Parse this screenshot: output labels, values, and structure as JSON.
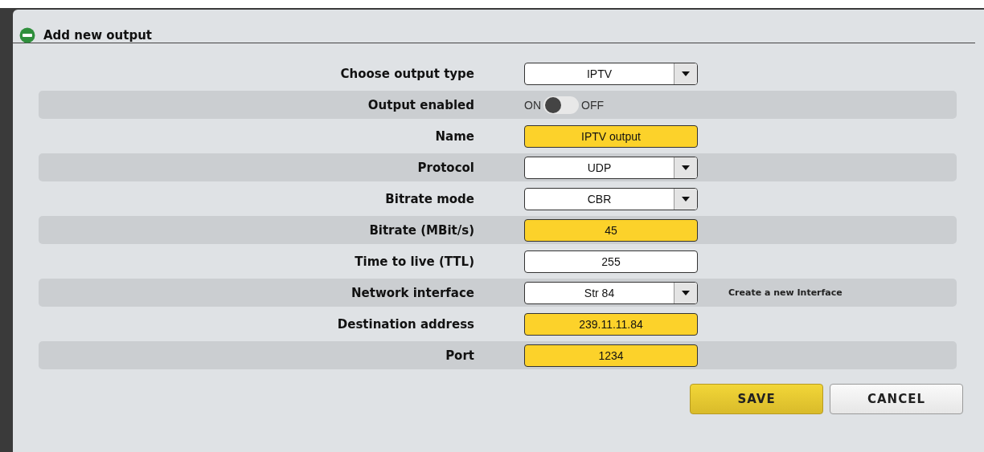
{
  "dialog": {
    "title": "Add new output"
  },
  "fields": [
    {
      "label": "Choose output type",
      "kind": "select",
      "value": "IPTV",
      "required": false
    },
    {
      "label": "Output enabled",
      "kind": "toggle",
      "on": false,
      "on_label": "ON",
      "off_label": "OFF"
    },
    {
      "label": "Name",
      "kind": "text",
      "value": "IPTV output",
      "required": true
    },
    {
      "label": "Protocol",
      "kind": "select",
      "value": "UDP",
      "required": false
    },
    {
      "label": "Bitrate mode",
      "kind": "select",
      "value": "CBR",
      "required": false
    },
    {
      "label": "Bitrate (MBit/s)",
      "kind": "text",
      "value": "45",
      "required": true
    },
    {
      "label": "Time to live (TTL)",
      "kind": "text",
      "value": "255",
      "required": false
    },
    {
      "label": "Network interface",
      "kind": "select",
      "value": "Str 84",
      "required": false,
      "link": "Create a new Interface"
    },
    {
      "label": "Destination address",
      "kind": "text",
      "value": "239.11.11.84",
      "required": true
    },
    {
      "label": "Port",
      "kind": "text",
      "value": "1234",
      "required": true
    }
  ],
  "buttons": [
    {
      "label": "SAVE",
      "kind": "primary"
    },
    {
      "label": "CANCEL",
      "kind": "secondary"
    }
  ]
}
